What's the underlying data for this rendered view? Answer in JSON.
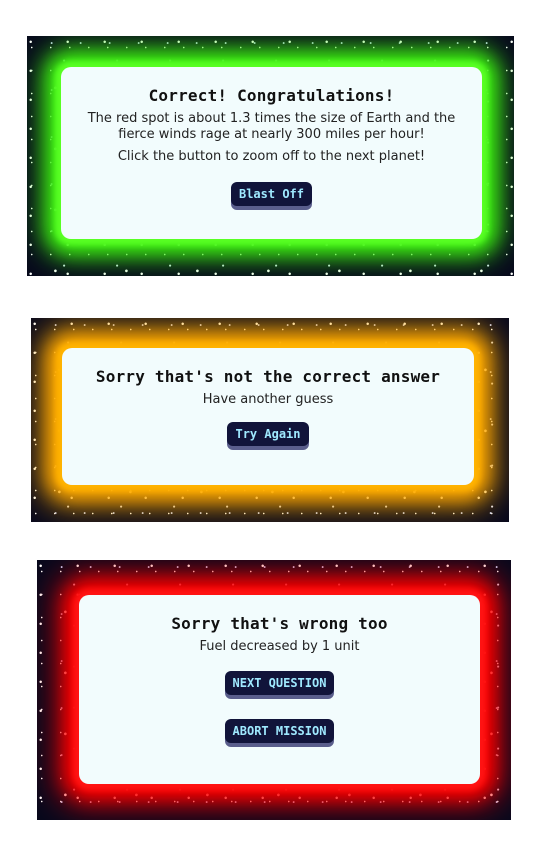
{
  "correct_dialog": {
    "title": "Correct! Congratulations!",
    "fact_line1": "The red spot is about 1.3 times the size of Earth and the",
    "fact_line2": "fierce winds rage at nearly 300 miles per hour!",
    "instruction": "Click the button to zoom off to the next planet!",
    "button_label": "Blast Off",
    "glow_color": "#3cf012"
  },
  "wrong_dialog": {
    "title": "Sorry that's not the correct answer",
    "message": "Have another guess",
    "button_label": "Try Again",
    "glow_color": "#ffa800"
  },
  "wrong_again_dialog": {
    "title": "Sorry that's wrong too",
    "message": "Fuel decreased by 1 unit",
    "next_button_label": "NEXT QUESTION",
    "abort_button_label": "ABORT MISSION",
    "glow_color": "#ff0000"
  }
}
